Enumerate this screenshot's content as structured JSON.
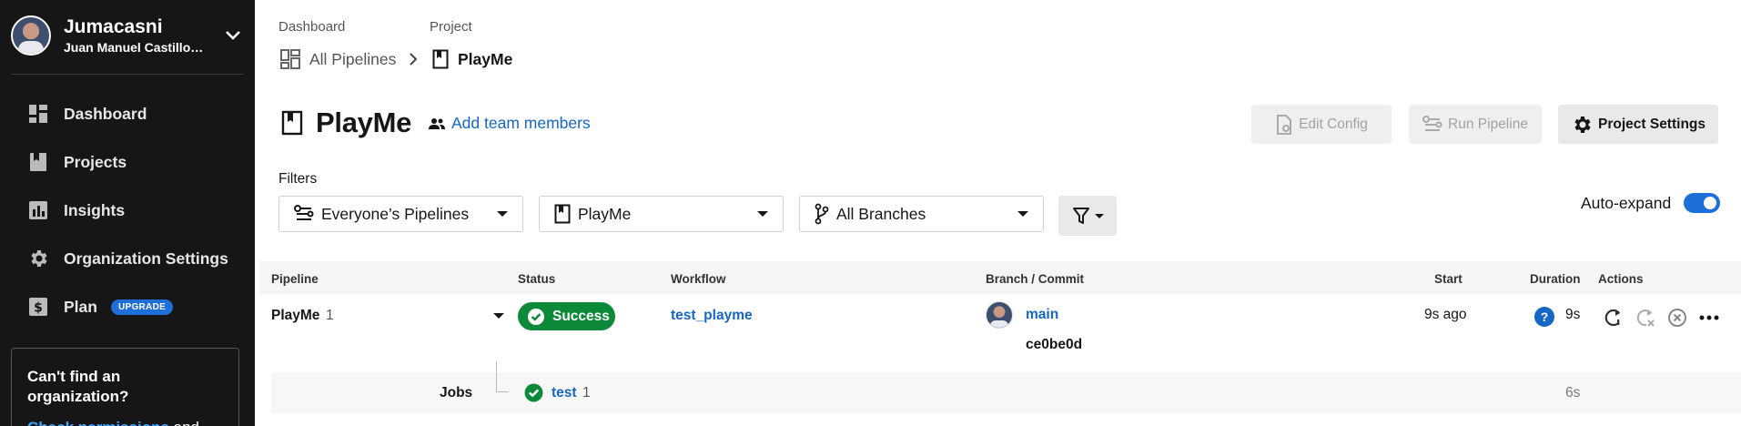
{
  "sidebar": {
    "org_name": "Jumacasni",
    "user_name": "Juan Manuel Castillo…",
    "nav": [
      {
        "label": "Dashboard",
        "icon": "dashboard-icon"
      },
      {
        "label": "Projects",
        "icon": "projects-icon"
      },
      {
        "label": "Insights",
        "icon": "insights-icon"
      },
      {
        "label": "Organization Settings",
        "icon": "gear-icon"
      },
      {
        "label": "Plan",
        "icon": "dollar-icon",
        "badge": "UPGRADE"
      }
    ],
    "promo": {
      "title": "Can't find an organization?",
      "link": "Check permissions",
      "text_after": " and"
    }
  },
  "breadcrumb": {
    "label1": "Dashboard",
    "label2": "Project",
    "item1": "All Pipelines",
    "item2": "PlayMe"
  },
  "page": {
    "title": "PlayMe",
    "add_team": "Add team members",
    "buttons": {
      "edit_config": "Edit Config",
      "run_pipeline": "Run Pipeline",
      "project_settings": "Project Settings"
    }
  },
  "filters": {
    "label": "Filters",
    "pipelines": "Everyone’s Pipelines",
    "project": "PlayMe",
    "branches": "All Branches",
    "auto_expand": "Auto-expand",
    "auto_expand_on": true
  },
  "table": {
    "headers": {
      "pipeline": "Pipeline",
      "status": "Status",
      "workflow": "Workflow",
      "branch": "Branch / Commit",
      "start": "Start",
      "duration": "Duration",
      "actions": "Actions"
    },
    "row": {
      "pipeline": "PlayMe",
      "number": "1",
      "status": "Success",
      "workflow": "test_playme",
      "branch": "main",
      "commit": "ce0be0d",
      "start": "9s ago",
      "duration_icon": "?",
      "duration": "9s"
    },
    "jobs": {
      "label": "Jobs",
      "job_name": "test",
      "job_number": "1",
      "duration": "6s"
    }
  },
  "colors": {
    "sidebar_bg": "#161616",
    "link": "#1666c3",
    "success": "#0c8a3a",
    "accent": "#1e6fd9"
  }
}
